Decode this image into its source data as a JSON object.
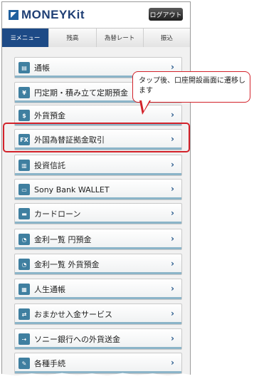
{
  "header": {
    "logo_text": "MONEYKit",
    "logout_label": "ログアウト"
  },
  "tabs": [
    {
      "label": "☰メニュー",
      "active": true
    },
    {
      "label": "残高",
      "active": false
    },
    {
      "label": "為替レート",
      "active": false
    },
    {
      "label": "振込",
      "active": false
    }
  ],
  "menu": {
    "items": [
      {
        "label": "通帳",
        "icon": "passbook-icon",
        "glyph": "▤"
      },
      {
        "label": "円定期・積み立て定期預金",
        "icon": "yen-icon",
        "glyph": "¥"
      },
      {
        "label": "外貨預金",
        "icon": "dollar-icon",
        "glyph": "$"
      },
      {
        "label": "外国為替証拠金取引",
        "icon": "fx-icon",
        "glyph": "FX"
      },
      {
        "label": "投資信託",
        "icon": "chart-icon",
        "glyph": "▥"
      },
      {
        "label": "Sony Bank WALLET",
        "icon": "wallet-card-icon",
        "glyph": "▭"
      },
      {
        "label": "カードローン",
        "icon": "loan-icon",
        "glyph": "▬"
      },
      {
        "label": "金利一覧 円預金",
        "icon": "rate-yen-icon",
        "glyph": "◔"
      },
      {
        "label": "金利一覧 外貨預金",
        "icon": "rate-foreign-icon",
        "glyph": "◔"
      },
      {
        "label": "人生通帳",
        "icon": "life-book-icon",
        "glyph": "▦"
      },
      {
        "label": "おまかせ入金サービス",
        "icon": "auto-deposit-icon",
        "glyph": "⇄"
      },
      {
        "label": "ソニー銀行への外貨送金",
        "icon": "remittance-icon",
        "glyph": "⇢"
      },
      {
        "label": "各種手続",
        "icon": "procedures-icon",
        "glyph": "✎"
      }
    ]
  },
  "callout": {
    "text": "タップ後、口座開設画面に遷移します"
  },
  "colors": {
    "brand_navy": "#1f3f75",
    "active_tab": "#1d4a86",
    "icon_teal": "#3f7fa0",
    "highlight_red": "#d3222a"
  }
}
